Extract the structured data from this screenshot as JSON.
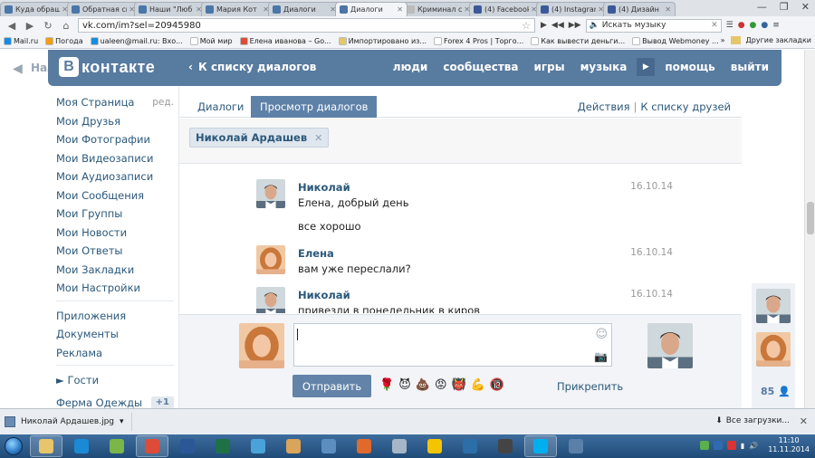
{
  "browser": {
    "tabs": [
      {
        "label": "Куда обращ",
        "color": "#4a76a8",
        "active": false
      },
      {
        "label": "Обратная св",
        "color": "#4a76a8",
        "active": false
      },
      {
        "label": "Наши \"Люб",
        "color": "#4a76a8",
        "active": false
      },
      {
        "label": "Мария Кот",
        "color": "#4a76a8",
        "active": false
      },
      {
        "label": "Диалоги",
        "color": "#4a76a8",
        "active": false
      },
      {
        "label": "Диалоги",
        "color": "#4a76a8",
        "active": true
      },
      {
        "label": "Криминал с",
        "color": "#bbbbbb",
        "active": false
      },
      {
        "label": "(4) Facebook",
        "color": "#3b5998",
        "active": false
      },
      {
        "label": "(4) Instagram",
        "color": "#3b5998",
        "active": false
      },
      {
        "label": "(4) Дизайн",
        "color": "#3b5998",
        "active": false
      }
    ],
    "url": "vk.com/im?sel=20945980",
    "music_placeholder": "Искать музыку",
    "bookmarks": [
      {
        "label": "Mail.ru",
        "color": "#168de2"
      },
      {
        "label": "Погода",
        "color": "#f39c12"
      },
      {
        "label": "ualeen@mail.ru: Вхо...",
        "color": "#168de2"
      },
      {
        "label": "Мой мир",
        "color": "#ffffff"
      },
      {
        "label": "Елена иванова – Go...",
        "color": "#dd4b39"
      },
      {
        "label": "Импортировано из...",
        "color": "#e5c66b"
      },
      {
        "label": "Forex 4 Pros | Торго...",
        "color": "#ffffff"
      },
      {
        "label": "Как вывести деньги...",
        "color": "#ffffff"
      },
      {
        "label": "Вывод Webmoney ...",
        "color": "#ffffff"
      }
    ],
    "other_bookmarks": "Другие закладки"
  },
  "vk": {
    "back_label": "Наз",
    "logo_letter": "В",
    "logo_text": "контакте",
    "to_dialogs": "К списку диалогов",
    "nav": {
      "people": "люди",
      "communities": "сообщества",
      "games": "игры",
      "music": "музыка",
      "help": "помощь",
      "logout": "выйти"
    },
    "sidebar": {
      "edit": "ред.",
      "items": [
        "Моя Страница",
        "Мои Друзья",
        "Мои Фотографии",
        "Мои Видеозаписи",
        "Мои Аудиозаписи",
        "Мои Сообщения",
        "Мои Группы",
        "Мои Новости",
        "Мои Ответы",
        "Мои Закладки",
        "Мои Настройки"
      ],
      "items2": [
        "Приложения",
        "Документы",
        "Реклама"
      ],
      "guests": "► Гости",
      "app": "Ферма Одежды",
      "app_badge": "+1"
    },
    "tabs": {
      "dialogs": "Диалоги",
      "view": "Просмотр диалогов",
      "actions": "Действия",
      "separator": "|",
      "friends": "К списку друзей"
    },
    "chip": {
      "name": "Николай Ардашев",
      "close": "✕"
    },
    "messages": [
      {
        "author": "Николай",
        "date": "16.10.14",
        "lines": [
          "Елена, добрый день",
          "все хорошо"
        ],
        "avatar": "man"
      },
      {
        "author": "Елена",
        "date": "16.10.14",
        "lines": [
          "вам уже переслали?"
        ],
        "avatar": "woman"
      },
      {
        "author": "Николай",
        "date": "16.10.14",
        "lines": [
          "привезли в понедельник в киров"
        ],
        "avatar": "man"
      }
    ],
    "compose": {
      "send": "Отправить",
      "attach": "Прикрепить",
      "emoji": [
        "🌹",
        "😈",
        "💩",
        "😡",
        "👹",
        "💪",
        "🔞"
      ]
    },
    "online_count": "85"
  },
  "downloads": {
    "file": "Николай Ардашев.jpg",
    "all": "Все загрузки..."
  },
  "taskbar": {
    "time": "11:10",
    "date": "11.11.2014",
    "apps": [
      {
        "name": "explorer",
        "color": "#e8c46a",
        "on": true
      },
      {
        "name": "ie",
        "color": "#1a8ad4",
        "on": false
      },
      {
        "name": "games",
        "color": "#7ab648",
        "on": false
      },
      {
        "name": "chrome",
        "color": "#dd4b39",
        "on": true
      },
      {
        "name": "word",
        "color": "#2b5797",
        "on": false
      },
      {
        "name": "excel",
        "color": "#1e7145",
        "on": false
      },
      {
        "name": "app7",
        "color": "#4aa3d8",
        "on": false
      },
      {
        "name": "paint",
        "color": "#d9a55a",
        "on": false
      },
      {
        "name": "network",
        "color": "#5c8fbf",
        "on": false
      },
      {
        "name": "app10",
        "color": "#e06a2c",
        "on": false
      },
      {
        "name": "calc",
        "color": "#a6b6c6",
        "on": false
      },
      {
        "name": "app12",
        "color": "#f2c500",
        "on": false
      },
      {
        "name": "app13",
        "color": "#2b6ea8",
        "on": false
      },
      {
        "name": "mic",
        "color": "#444444",
        "on": false
      },
      {
        "name": "skype",
        "color": "#00aff0",
        "on": true
      },
      {
        "name": "photo",
        "color": "#5a7fa8",
        "on": false
      }
    ]
  }
}
